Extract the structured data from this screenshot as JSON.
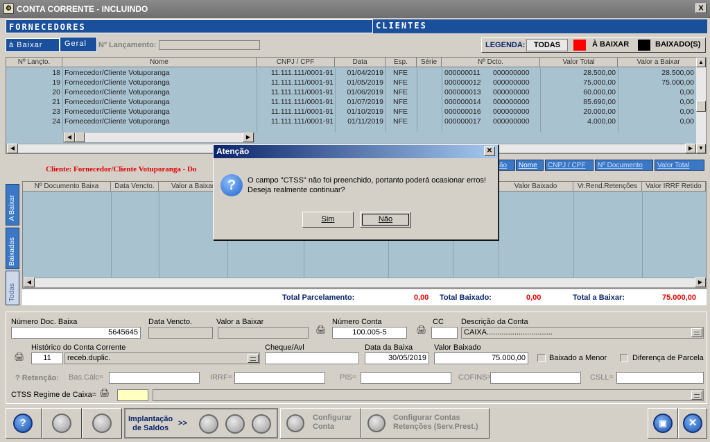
{
  "window": {
    "title": "CONTA CORRENTE - INCLUINDO",
    "close_label": "X"
  },
  "header": {
    "fornecedores": "FORNECEDORES",
    "clientes": "CLIENTES"
  },
  "tabs": {
    "baixar": "à Baixar",
    "geral": "Geral"
  },
  "lancamento": {
    "label": "Nº Lançamento:",
    "value": ""
  },
  "legenda": {
    "label": "LEGENDA:",
    "todas": "TODAS",
    "a_baixar": "À BAIXAR",
    "baixados": "BAIXADO(S)",
    "a_baixar_color": "#ff0000",
    "baixados_color": "#000000"
  },
  "grid": {
    "columns": [
      "Nº Lançto.",
      "Nome",
      "CNPJ / CPF",
      "Data",
      "Esp.",
      "Série",
      "Nº Dcto.",
      "Valor Total",
      "Valor a Baixar"
    ],
    "rows": [
      [
        "18",
        "Fornecedor/Cliente Votuporanga",
        "11.111.111/0001-91",
        "01/04/2019",
        "NFE",
        "",
        "000000011",
        "000000000",
        "28.500,00",
        "28.500,00"
      ],
      [
        "19",
        "Fornecedor/Cliente Votuporanga",
        "11.111.111/0001-91",
        "01/05/2019",
        "NFE",
        "",
        "000000012",
        "000000000",
        "75.000,00",
        "75.000,00"
      ],
      [
        "20",
        "Fornecedor/Cliente Votuporanga",
        "11.111.111/0001-91",
        "01/06/2019",
        "NFE",
        "",
        "000000013",
        "000000000",
        "60.000,00",
        "0,00"
      ],
      [
        "21",
        "Fornecedor/Cliente Votuporanga",
        "11.111.111/0001-91",
        "01/07/2019",
        "NFE",
        "",
        "000000014",
        "000000000",
        "85.690,00",
        "0,00"
      ],
      [
        "23",
        "Fornecedor/Cliente Votuporanga",
        "11.111.111/0001-91",
        "01/10/2019",
        "NFE",
        "",
        "000000016",
        "000000000",
        "20.000,00",
        "0,00"
      ],
      [
        "24",
        "Fornecedor/Cliente Votuporanga",
        "11.111.111/0001-91",
        "01/11/2019",
        "NFE",
        "",
        "000000017",
        "000000000",
        "4.000,00",
        "0,00"
      ]
    ]
  },
  "cliente_line": "Cliente: Fornecedor/Cliente Votuporanga - Do",
  "order_tabs": [
    "ão",
    "Nome",
    "CNPJ / CPF",
    "Nº Documento",
    "Valor Total"
  ],
  "side_tabs": [
    "A Baixar",
    "Baixadas",
    "Todas"
  ],
  "grid2": {
    "columns": [
      "Nº Documento Baixa",
      "Data Vencto.",
      "Valor a Baixar",
      "Valor Baixado",
      "Vr.Rend.Retenções",
      "Valor IRRF Retido"
    ]
  },
  "totals": {
    "parcelamento_label": "Total Parcelamento:",
    "parcelamento": "0,00",
    "baixado_label": "Total Baixado:",
    "baixado": "0,00",
    "a_baixar_label": "Total a Baixar:",
    "a_baixar": "75.000,00"
  },
  "form": {
    "num_doc_label": "Número Doc. Baixa",
    "num_doc": "5645645",
    "data_vencto_label": "Data Vencto.",
    "data_vencto": "",
    "valor_baixar_label": "Valor a Baixar",
    "valor_baixar": "",
    "numero_conta_label": "Número Conta",
    "numero_conta": "100.005-5",
    "cc_label": "CC",
    "cc": "",
    "desc_conta_label": "Descrição da Conta",
    "desc_conta": "CAIXA...............................",
    "historico_label": "Histórico do Conta Corrente",
    "historico_code": "11",
    "historico_text": "receb.duplic.",
    "cheque_label": "Cheque/Avl",
    "cheque": "",
    "data_baixa_label": "Data da Baixa",
    "data_baixa": "30/05/2019",
    "valor_baixado_label": "Valor Baixado",
    "valor_baixado": "75.000,00",
    "baixado_menor_label": "Baixado a Menor",
    "diferenca_label": "Diferença de Parcela",
    "retencao_label": "? Retenção:",
    "bas_calc_label": "Bas.Cálc=",
    "irrf_label": "IRRF=",
    "pis_label": "PIS=",
    "cofins_label": "COFINS=",
    "csll_label": "CSLL=",
    "ctss_label": "CTSS Regime de Caixa="
  },
  "toolbar": {
    "help": "?",
    "implantacao": "Implantação\nde Saldos",
    "arrows": ">>",
    "configurar_conta": "Configurar\nConta",
    "configurar_contas_ret": "Configurar Contas\nRetenções (Serv.Prest.)"
  },
  "dialog": {
    "title": "Atenção",
    "message": "O campo \"CTSS\" não foi preenchido, portanto poderá ocasionar erros!\nDeseja realmente continuar?",
    "yes": "Sim",
    "no": "Não"
  }
}
